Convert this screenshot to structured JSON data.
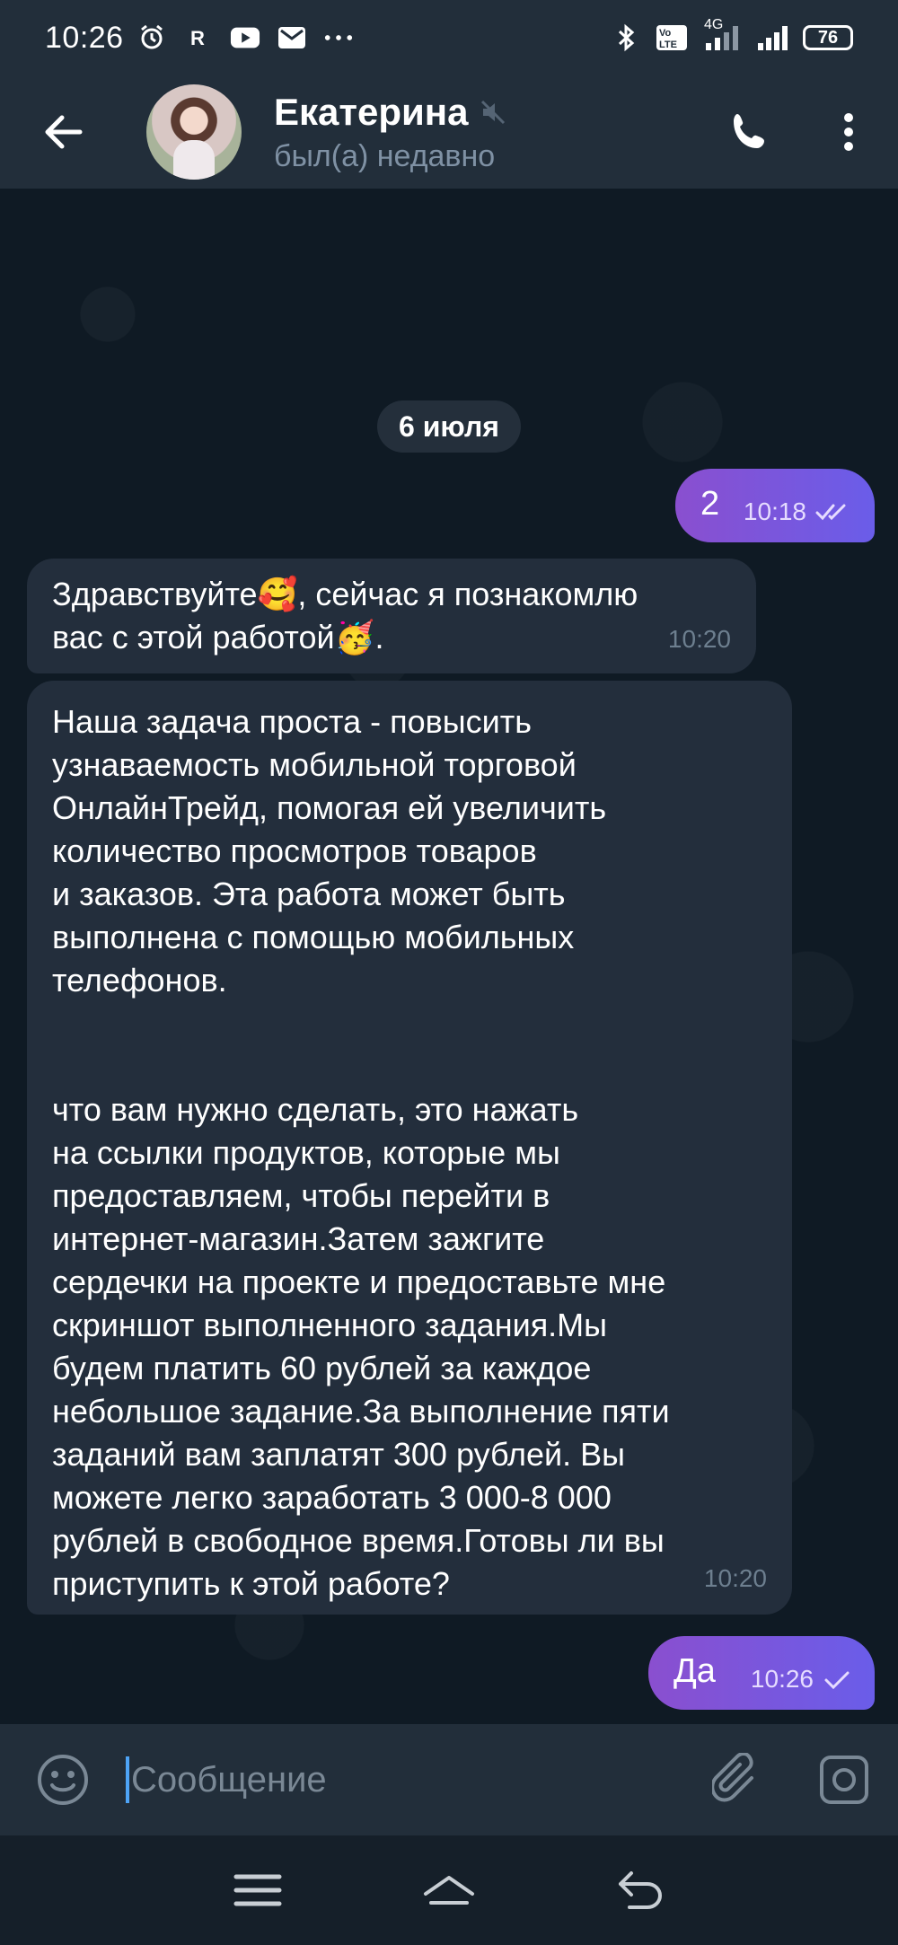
{
  "status_bar": {
    "time": "10:26",
    "battery": "76",
    "network": "4G",
    "lte_label": "LTE",
    "icons": [
      "alarm-icon",
      "r-icon",
      "youtube-icon",
      "gmail-icon",
      "more-dots-icon",
      "bluetooth-icon",
      "volte-icon",
      "signal-icon",
      "signal-icon-2",
      "battery-icon"
    ]
  },
  "header": {
    "name": "Екатерина",
    "status": "был(а) недавно",
    "muted": true
  },
  "chat": {
    "date": "6 июля",
    "messages": [
      {
        "direction": "out",
        "text": "2",
        "time": "10:18",
        "read": true
      },
      {
        "direction": "in",
        "text": "Здравствуйте🥰, сейчас я познакомлю\nвас с этой работой🥳.",
        "time": "10:20"
      },
      {
        "direction": "in",
        "text": "Наша задача проста - повысить\nузнаваемость мобильной торговой\nОнлайнТрейд, помогая ей увеличить\nколичество просмотров товаров\nи заказов. Эта работа может быть\nвыполнена с помощью мобильных\nтелефонов.\n\n\nчто вам нужно сделать, это нажать\nна ссылки продуктов, которые мы\nпредоставляем, чтобы перейти в\nинтернет-магазин.Затем зажгите\nсердечки на проекте и предоставьте мне\nскриншот выполненного задания.Мы\nбудем платить 60 рублей за каждое\nнебольшое задание.За выполнение пяти\nзаданий вам заплатят 300 рублей. Вы\nможете легко заработать 3 000-8 000\nрублей в свободное время.Готовы ли вы\nприступить к этой работе?",
        "time": "10:20"
      },
      {
        "direction": "out",
        "text": "Да",
        "time": "10:26",
        "read": false
      }
    ]
  },
  "input": {
    "placeholder": "Сообщение"
  },
  "colors": {
    "header_bg": "#222e3a",
    "chat_bg": "#0f1a24",
    "incoming_bubble": "#232e3c",
    "outgoing_bubble_start": "#8a4fcf",
    "outgoing_bubble_end": "#6a5de9",
    "status_text": "#7f91a4",
    "caret": "#4ea4f6"
  }
}
